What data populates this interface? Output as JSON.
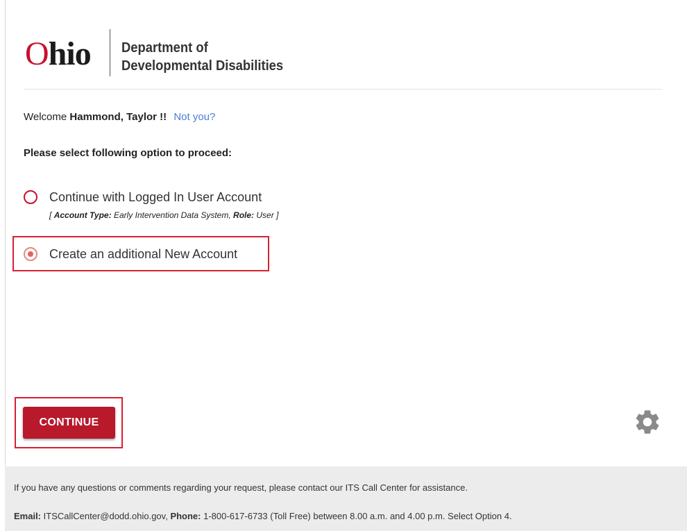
{
  "header": {
    "logo_o": "O",
    "logo_rest": "hio",
    "dept_line1": "Department of",
    "dept_line2": "Developmental Disabilities"
  },
  "welcome": {
    "prefix": "Welcome",
    "name": "Hammond, Taylor !!",
    "not_you": "Not you?"
  },
  "prompt": "Please select following option to proceed:",
  "options": [
    {
      "label": "Continue with Logged In User Account",
      "selected": false,
      "note": {
        "open": "[",
        "account_type_label": "Account Type:",
        "account_type_value": "Early Intervention Data System,",
        "role_label": "Role:",
        "role_value": "User",
        "close": "]"
      }
    },
    {
      "label": "Create an additional New Account",
      "selected": true
    }
  ],
  "continue_label": "CONTINUE",
  "footer": {
    "line1": "If you have any questions or comments regarding your request, please contact our ITS Call Center for assistance.",
    "email_label": "Email:",
    "email_value": "ITSCallCenter@dodd.ohio.gov,",
    "phone_label": "Phone:",
    "phone_value": "1-800-617-6733 (Toll Free) between 8.00 a.m. and 4.00 p.m. Select Option 4."
  },
  "colors": {
    "brand_red": "#b8192b",
    "link_blue": "#4a7fd4",
    "highlight_red": "#d6202f"
  },
  "icons": {
    "settings": "gear-icon"
  }
}
